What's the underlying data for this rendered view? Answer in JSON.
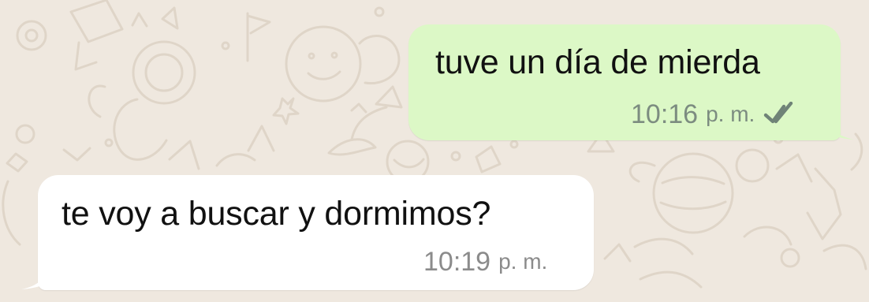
{
  "chat": {
    "background_color": "#efe8df",
    "pattern": "doodle-wallpaper-icon",
    "messages": [
      {
        "direction": "outgoing",
        "bubble_color": "#dcf8c6",
        "text": "tuve un día de mierda",
        "time": "10:16",
        "time_suffix": "p. m.",
        "status": "read-check-icon"
      },
      {
        "direction": "incoming",
        "bubble_color": "#ffffff",
        "text": "te voy a buscar y dormimos?",
        "time": "10:19",
        "time_suffix": "p. m."
      }
    ]
  }
}
